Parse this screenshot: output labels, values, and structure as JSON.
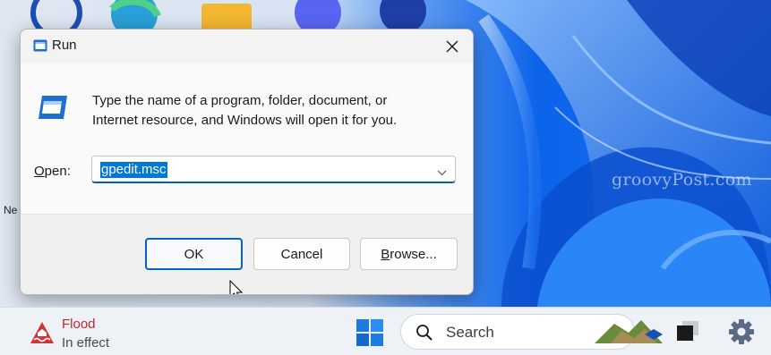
{
  "desktop": {
    "watermark": "groovyPost.com",
    "icon_label_fragment": "Ne"
  },
  "dialog": {
    "title": "Run",
    "description_line1": "Type the name of a program, folder, document, or",
    "description_line2": "Internet resource, and Windows will open it for you.",
    "open_label_mnemonic": "O",
    "open_label_rest": "pen:",
    "open_value": "gpedit.msc",
    "ok_label": "OK",
    "cancel_label": "Cancel",
    "browse_mnemonic": "B",
    "browse_rest": "rowse..."
  },
  "taskbar": {
    "weather_title": "Flood",
    "weather_subtitle": "In effect",
    "search_label": "Search"
  },
  "colors": {
    "accent": "#0067c0",
    "selection": "#0078d4",
    "alert": "#c4262e"
  },
  "icons": [
    "run-icon",
    "close-icon",
    "chevron-down-icon",
    "flood-warning-icon",
    "windows-start-icon",
    "search-icon",
    "task-view-icon",
    "settings-icon"
  ]
}
